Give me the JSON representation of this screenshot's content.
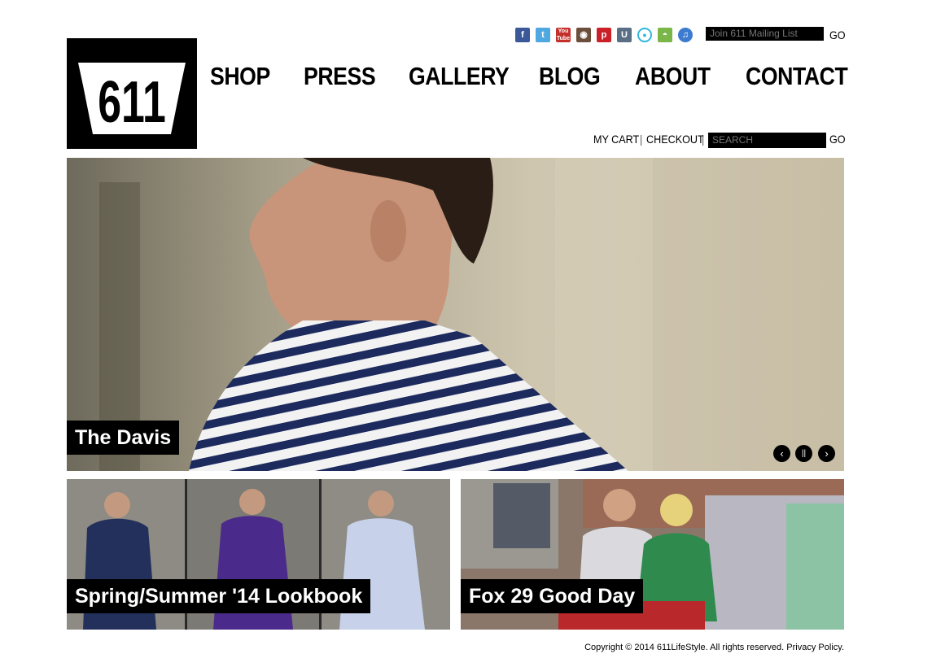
{
  "brand": {
    "logo_text": "611"
  },
  "nav": {
    "items": [
      "SHOP",
      "PRESS",
      "GALLERY",
      "BLOG",
      "ABOUT",
      "CONTACT"
    ]
  },
  "social": {
    "icons": [
      "facebook-icon",
      "twitter-icon",
      "youtube-icon",
      "instagram-icon",
      "pinterest-icon",
      "ustream-icon",
      "circle-icon",
      "grooveshark-icon",
      "itunes-icon"
    ]
  },
  "mailing": {
    "placeholder": "Join 611 Mailing List",
    "go": "GO"
  },
  "utility": {
    "my_cart": "MY CART",
    "sep": "|",
    "checkout": "CHECKOUT",
    "search_placeholder": "SEARCH",
    "go": "GO"
  },
  "hero": {
    "caption": "The Davis",
    "prev": "‹",
    "pause": "||",
    "next": "›"
  },
  "tiles": [
    {
      "caption": "Spring/Summer '14 Lookbook"
    },
    {
      "caption": "Fox 29 Good Day"
    }
  ],
  "footer": {
    "copyright": "Copyright © 2014 611LifeStyle. All rights reserved.",
    "privacy": "Privacy Policy."
  },
  "colors": {
    "facebook": "#3b5998",
    "twitter": "#4fa8e0",
    "youtube": "#c4302b",
    "instagram": "#6b4f3c",
    "pinterest": "#cb2027",
    "ustream": "#5a6e85",
    "circle": "#2fb7e0",
    "grooveshark": "#7ab648",
    "itunes": "#3d7bd0"
  }
}
